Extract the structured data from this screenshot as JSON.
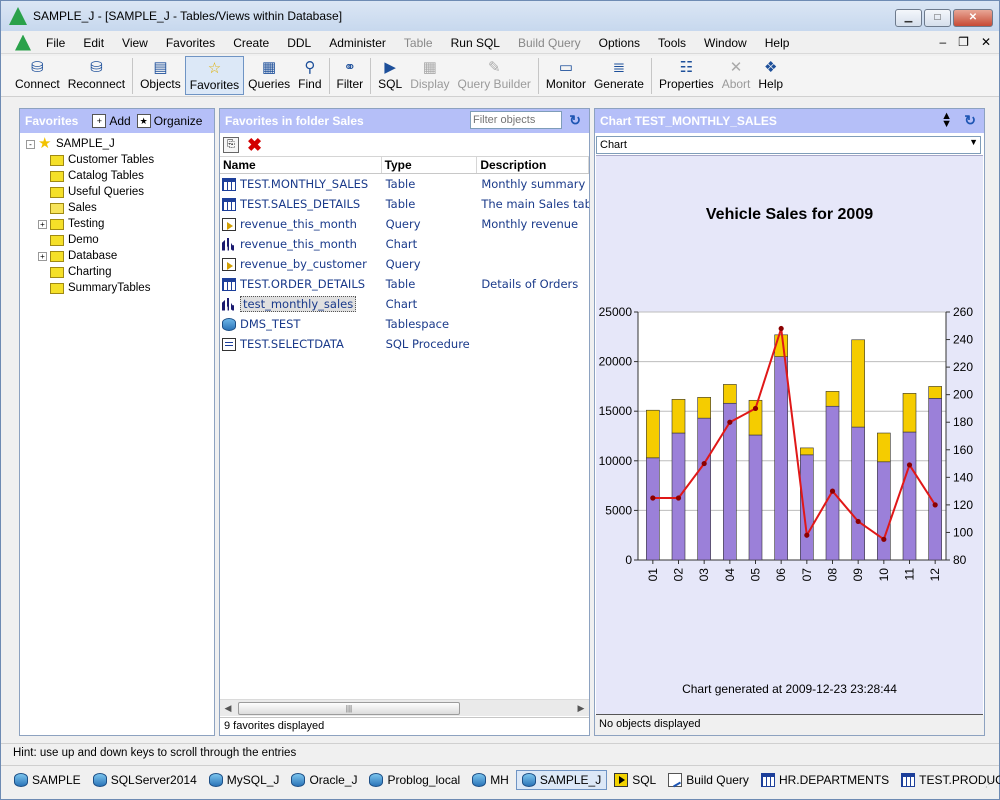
{
  "window": {
    "title": "SAMPLE_J - [SAMPLE_J - Tables/Views within Database]"
  },
  "menu": [
    {
      "label": "File",
      "disabled": false
    },
    {
      "label": "Edit",
      "disabled": false
    },
    {
      "label": "View",
      "disabled": false
    },
    {
      "label": "Favorites",
      "disabled": false
    },
    {
      "label": "Create",
      "disabled": false
    },
    {
      "label": "DDL",
      "disabled": false
    },
    {
      "label": "Administer",
      "disabled": false
    },
    {
      "label": "Table",
      "disabled": true
    },
    {
      "label": "Run SQL",
      "disabled": false
    },
    {
      "label": "Build Query",
      "disabled": true
    },
    {
      "label": "Options",
      "disabled": false
    },
    {
      "label": "Tools",
      "disabled": false
    },
    {
      "label": "Window",
      "disabled": false
    },
    {
      "label": "Help",
      "disabled": false
    }
  ],
  "toolbar": [
    {
      "label": "Connect",
      "icon": "connect-icon"
    },
    {
      "label": "Reconnect",
      "icon": "reconnect-icon"
    },
    {
      "label": "Objects",
      "icon": "objects-icon"
    },
    {
      "label": "Favorites",
      "icon": "favorites-star-icon",
      "active": true
    },
    {
      "label": "Queries",
      "icon": "queries-icon"
    },
    {
      "label": "Find",
      "icon": "find-magnifier-icon"
    },
    {
      "label": "Filter",
      "icon": "filter-binoculars-icon"
    },
    {
      "label": "SQL",
      "icon": "sql-icon"
    },
    {
      "label": "Display",
      "icon": "display-icon",
      "disabled": true
    },
    {
      "label": "Query Builder",
      "icon": "query-builder-icon",
      "disabled": true
    },
    {
      "label": "Monitor",
      "icon": "monitor-icon"
    },
    {
      "label": "Generate",
      "icon": "generate-icon"
    },
    {
      "label": "Properties",
      "icon": "properties-icon"
    },
    {
      "label": "Abort",
      "icon": "abort-icon",
      "disabled": true
    },
    {
      "label": "Help",
      "icon": "help-book-icon"
    }
  ],
  "favorites_panel": {
    "title": "Favorites",
    "add_label": "Add",
    "organize_label": "Organize",
    "tree": [
      {
        "label": "SAMPLE_J",
        "level": 0,
        "type": "root",
        "expander": "-"
      },
      {
        "label": "Customer Tables",
        "level": 1,
        "type": "folder"
      },
      {
        "label": "Catalog Tables",
        "level": 1,
        "type": "folder"
      },
      {
        "label": "Useful Queries",
        "level": 1,
        "type": "folder"
      },
      {
        "label": "Sales",
        "level": 1,
        "type": "folder-open"
      },
      {
        "label": "Testing",
        "level": 1,
        "type": "folder",
        "expander": "+"
      },
      {
        "label": "Demo",
        "level": 1,
        "type": "folder"
      },
      {
        "label": "Database",
        "level": 1,
        "type": "folder",
        "expander": "+"
      },
      {
        "label": "Charting",
        "level": 1,
        "type": "folder"
      },
      {
        "label": "SummaryTables",
        "level": 1,
        "type": "folder"
      }
    ]
  },
  "list_panel": {
    "title": "Favorites in folder Sales",
    "filter_placeholder": "Filter objects",
    "columns": [
      "Name",
      "Type",
      "Description"
    ],
    "rows": [
      {
        "name": "TEST.MONTHLY_SALES",
        "type": "Table",
        "desc": "Monthly summary o",
        "icon": "table"
      },
      {
        "name": "TEST.SALES_DETAILS",
        "type": "Table",
        "desc": "The main Sales tab",
        "icon": "table"
      },
      {
        "name": "revenue_this_month",
        "type": "Query",
        "desc": "Monthly revenue",
        "icon": "query"
      },
      {
        "name": "revenue_this_month",
        "type": "Chart",
        "desc": "",
        "icon": "chart"
      },
      {
        "name": "revenue_by_customer",
        "type": "Query",
        "desc": "",
        "icon": "query"
      },
      {
        "name": "TEST.ORDER_DETAILS",
        "type": "Table",
        "desc": "Details of Orders",
        "icon": "table"
      },
      {
        "name": "test_monthly_sales",
        "type": "Chart",
        "desc": "",
        "icon": "chart",
        "selected": true
      },
      {
        "name": "DMS_TEST",
        "type": "Tablespace",
        "desc": "",
        "icon": "ts"
      },
      {
        "name": "TEST.SELECTDATA",
        "type": "SQL Procedure",
        "desc": "",
        "icon": "proc"
      }
    ],
    "status": "9 favorites displayed"
  },
  "chart_panel": {
    "title": "Chart TEST_MONTHLY_SALES",
    "select_value": "Chart",
    "generated": "Chart generated at 2009-12-23 23:28:44",
    "status": "No objects displayed"
  },
  "chart_data": {
    "type": "bar",
    "title": "Vehicle Sales for 2009",
    "stacked": true,
    "categories": [
      "01",
      "02",
      "03",
      "04",
      "05",
      "06",
      "07",
      "08",
      "09",
      "10",
      "11",
      "12"
    ],
    "series": [
      {
        "values": [
          10300,
          12800,
          14300,
          15800,
          12600,
          20500,
          10600,
          15500,
          13400,
          9900,
          12900,
          16300
        ],
        "color": "#9b80d9"
      },
      {
        "values": [
          4800,
          3400,
          2100,
          1900,
          3500,
          2200,
          700,
          1500,
          8800,
          2900,
          3900,
          1200
        ],
        "color": "#f5cc00"
      },
      {
        "values": [
          125,
          125,
          150,
          180,
          190,
          248,
          98,
          130,
          108,
          95,
          149,
          120
        ],
        "color": "#e01818",
        "kind": "line",
        "axis": "right"
      }
    ],
    "ylim": [
      0,
      25000
    ],
    "yticks": [
      "0",
      "5000",
      "10000",
      "15000",
      "20000",
      "25000"
    ],
    "y2lim": [
      80,
      260
    ],
    "y2ticks": [
      "80",
      "100",
      "120",
      "140",
      "160",
      "180",
      "200",
      "220",
      "240",
      "260"
    ],
    "grid": true
  },
  "hint": "Hint: use up and down keys to scroll through the entries",
  "tasks": [
    {
      "label": "SAMPLE",
      "icon": "db"
    },
    {
      "label": "SQLServer2014",
      "icon": "db"
    },
    {
      "label": "MySQL_J",
      "icon": "db"
    },
    {
      "label": "Oracle_J",
      "icon": "db"
    },
    {
      "label": "Problog_local",
      "icon": "db"
    },
    {
      "label": "MH",
      "icon": "db"
    },
    {
      "label": "SAMPLE_J",
      "icon": "db",
      "active": true
    },
    {
      "label": "SQL",
      "icon": "sql"
    },
    {
      "label": "Build Query",
      "icon": "bq"
    },
    {
      "label": "HR.DEPARTMENTS",
      "icon": "tbl"
    },
    {
      "label": "TEST.PRODUCT",
      "icon": "tbl"
    }
  ]
}
